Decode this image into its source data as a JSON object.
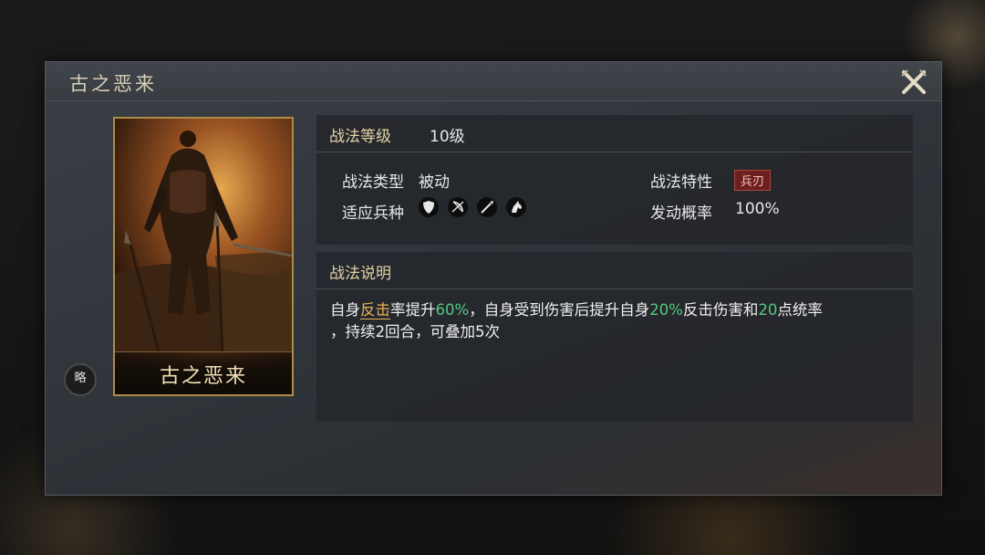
{
  "dialog": {
    "title": "古之恶来"
  },
  "card": {
    "name": "古之恶来",
    "badge": "略"
  },
  "info": {
    "level_label": "战法等级",
    "level_value": "10级",
    "type_label": "战法类型",
    "type_value": "被动",
    "feature_label": "战法特性",
    "feature_tag": "兵刃",
    "troop_label": "适应兵种",
    "troop_icons": [
      "shield-icon",
      "bow-icon",
      "spear-icon",
      "horse-icon"
    ],
    "rate_label": "发动概率",
    "rate_value": "100%"
  },
  "description": {
    "header": "战法说明",
    "p1": "自身",
    "p2": "反击",
    "p3": "率提升",
    "p4": "60%",
    "p5": "，自身受到伤害后提升自身",
    "p6": "20%",
    "p7": "反击伤害和",
    "p8": "20",
    "p9": "点统率",
    "p10": "，持续2回合，可叠加5次"
  },
  "colors": {
    "accent_gold": "#e4d2a6",
    "highlight_green": "#54c97f",
    "highlight_orange": "#e6b35a",
    "tag_red": "#6e1f1f"
  }
}
